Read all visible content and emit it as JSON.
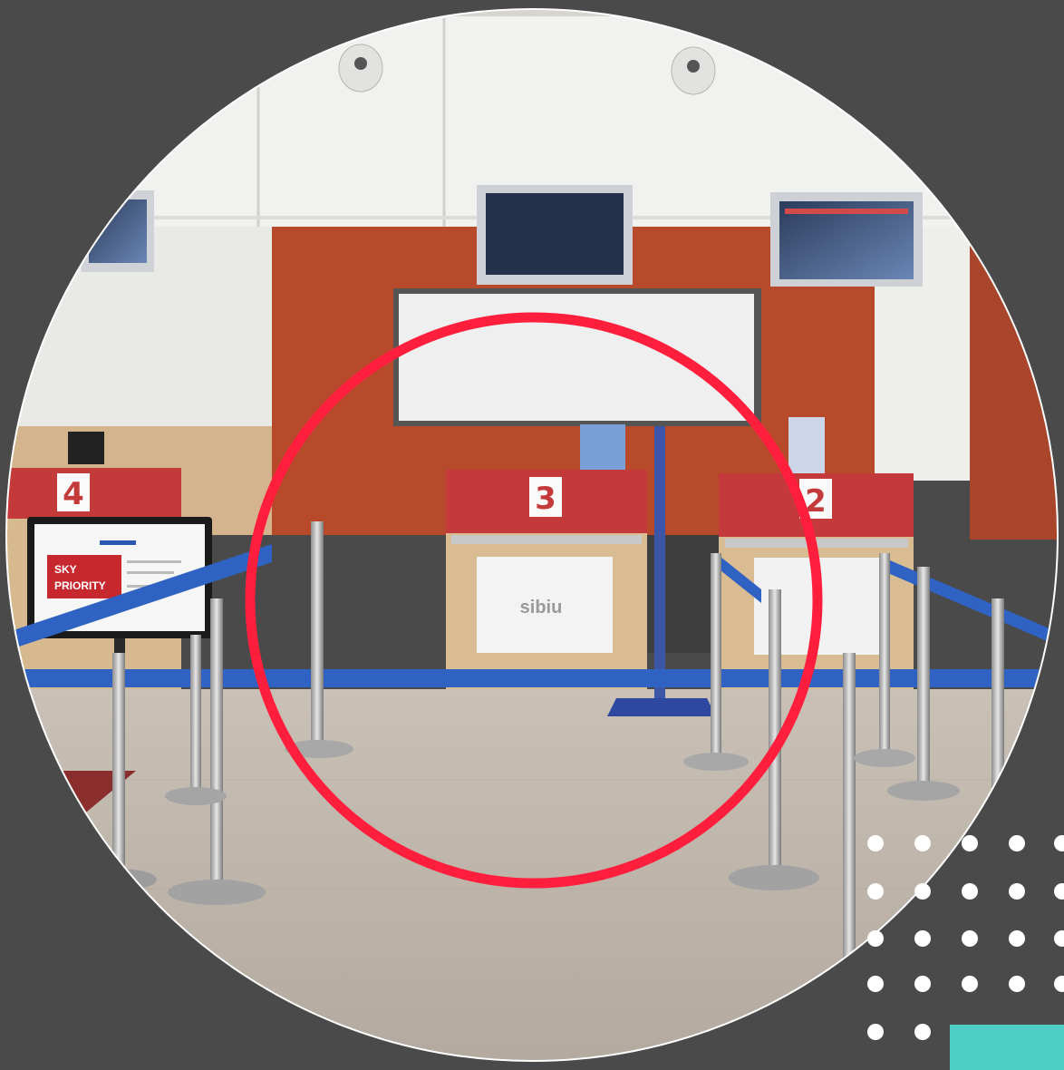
{
  "photo": {
    "counters": [
      {
        "label": "4"
      },
      {
        "label": "3"
      },
      {
        "label": "2"
      }
    ],
    "priority_sign": {
      "line1": "SKY",
      "line2": "PRIORITY"
    },
    "counter_logo": "sibiu"
  },
  "colors": {
    "background": "#4a4a4a",
    "highlight_ring": "#ff1f3d",
    "accent_block": "#4ecdc4",
    "decor_dots": "#ffffff",
    "counter_wall": "#b84a2c",
    "counter_red": "#c43a3a"
  }
}
